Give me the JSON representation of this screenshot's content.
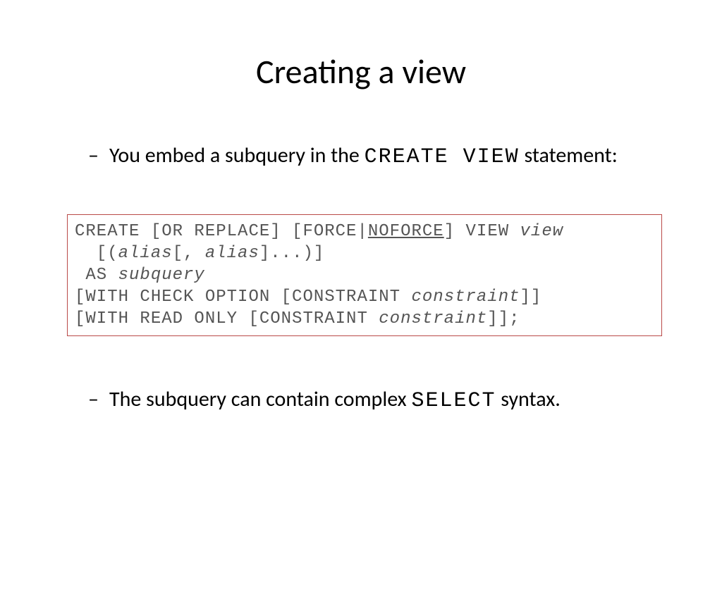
{
  "title": "Creating a view",
  "bullet1": {
    "pre": "You embed a subquery in the ",
    "mono": "CREATE VIEW",
    "post": " statement:"
  },
  "code": {
    "l1a": "CREATE [OR REPLACE] [FORCE|",
    "l1u": "NOFORCE",
    "l1b": "] VIEW ",
    "l1v": "view",
    "l2a": "  [(",
    "l2i": "alias",
    "l2b": "[, ",
    "l2i2": "alias",
    "l2c": "]...)]",
    "l3a": " AS ",
    "l3i": "subquery",
    "l4a": "[WITH CHECK OPTION [CONSTRAINT ",
    "l4i": "constraint",
    "l4b": "]]",
    "l5a": "[WITH READ ONLY [CONSTRAINT ",
    "l5i": "constraint",
    "l5b": "]];"
  },
  "bullet2": {
    "pre": "The subquery can contain complex ",
    "mono": "SELECT",
    "post": " syntax."
  }
}
